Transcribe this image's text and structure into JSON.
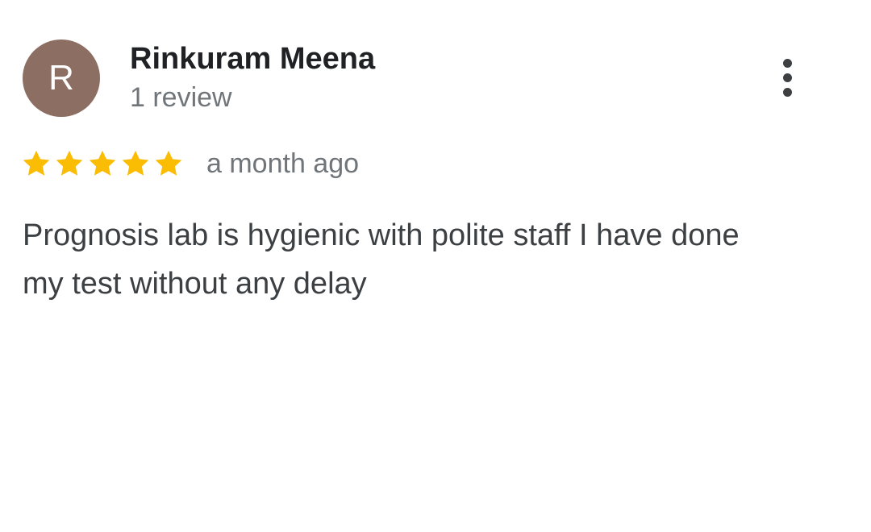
{
  "review": {
    "avatar_initial": "R",
    "avatar_color": "#8d6e63",
    "author_name": "Rinkuram Meena",
    "review_count": "1 review",
    "rating": 5,
    "rating_max": 5,
    "star_color": "#fbbc04",
    "date": "a month ago",
    "text": "Prognosis lab is hygienic with polite staff I have done my test without any delay"
  },
  "icons": {
    "more_menu": "more-vert-icon",
    "star": "star-icon"
  },
  "colors": {
    "menu_dots": "#3c4043"
  }
}
